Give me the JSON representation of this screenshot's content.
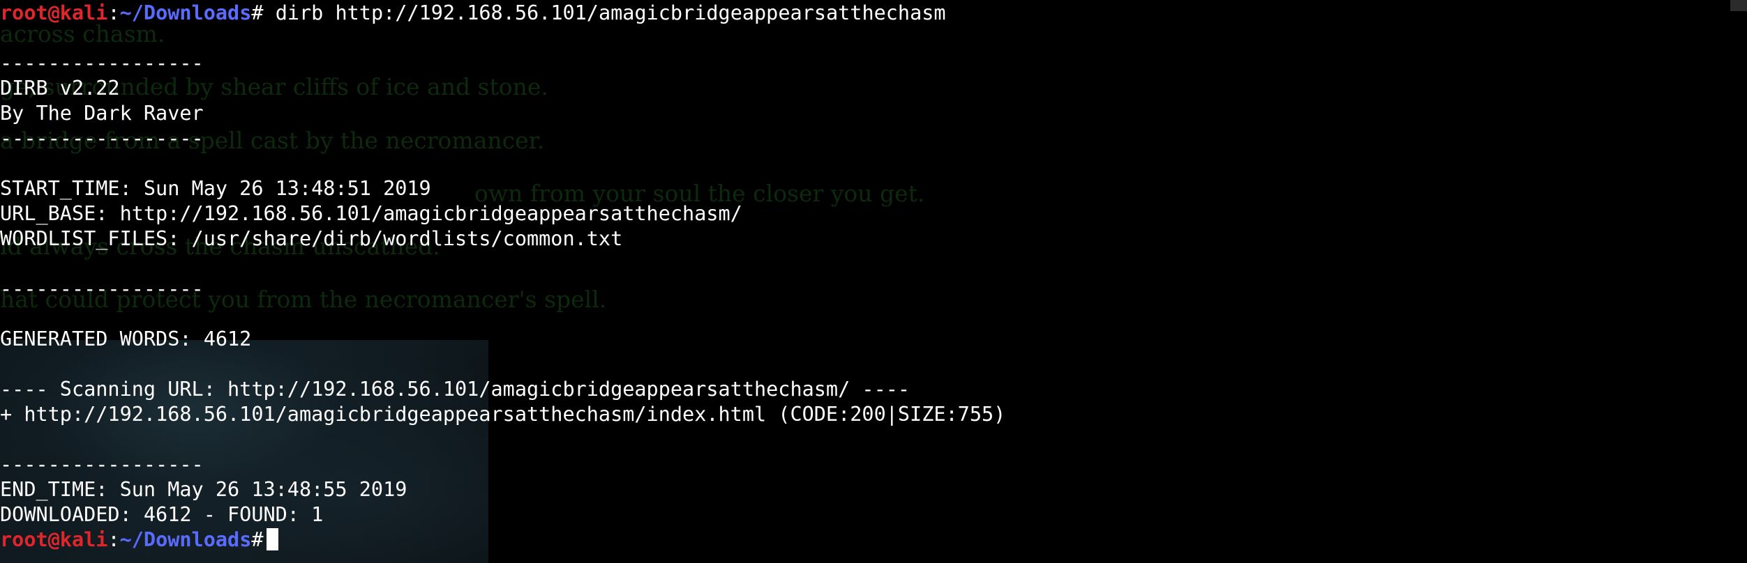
{
  "colors": {
    "background": "#000000",
    "text": "#ffffff",
    "prompt_user": "#e0262b",
    "prompt_path": "#5a6cff",
    "background_text": "#0d2a0d"
  },
  "prompt": {
    "user_host": "root@kali",
    "colon": ":",
    "path": "~/Downloads",
    "symbol": "#"
  },
  "command": " dirb http://192.168.56.101/amagicbridgeappearsatthechasm",
  "output": {
    "sep1": "-----------------",
    "version": "DIRB v2.22",
    "author": "By The Dark Raver",
    "sep2": "-----------------",
    "start_time": "START_TIME: Sun May 26 13:48:51 2019",
    "url_base": "URL_BASE: http://192.168.56.101/amagicbridgeappearsatthechasm/",
    "wordlist": "WORDLIST_FILES: /usr/share/dirb/wordlists/common.txt",
    "sep3": "-----------------",
    "generated_words": "GENERATED WORDS: 4612",
    "scanning": "---- Scanning URL: http://192.168.56.101/amagicbridgeappearsatthechasm/ ----",
    "result": "+ http://192.168.56.101/amagicbridgeappearsatthechasm/index.html (CODE:200|SIZE:755)",
    "sep4": "-----------------",
    "end_time": "END_TIME: Sun May 26 13:48:55 2019",
    "downloaded": "DOWNLOADED: 4612 - FOUND: 1"
  },
  "background_text": {
    "line1": "across chasm.",
    "line2": "ge, surrounded by shear cliffs of ice and stone.",
    "line3": "a bridge from a spell cast by the necromancer.",
    "line4": "own from your soul the closer you get.",
    "line5": "ld always cross the chasm unscathed.",
    "line6": "hat could protect you from the necromancer's spell."
  }
}
